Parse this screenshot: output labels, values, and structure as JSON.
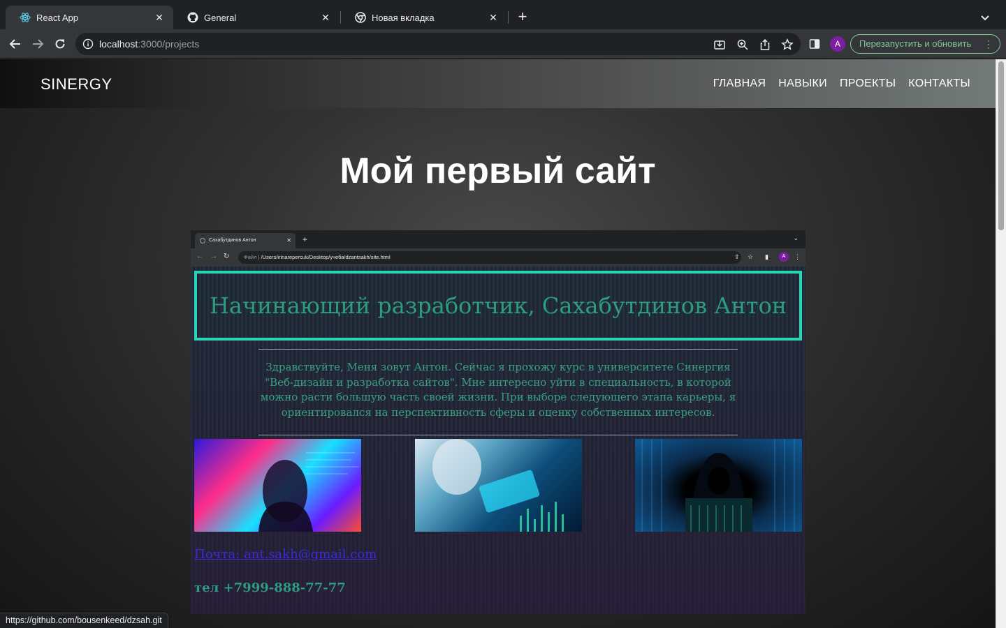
{
  "browser": {
    "tabs": [
      {
        "title": "React App",
        "icon": "react-icon",
        "active": true
      },
      {
        "title": "General",
        "icon": "github-icon",
        "active": false
      },
      {
        "title": "Новая вкладка",
        "icon": "chrome-icon",
        "active": false
      }
    ],
    "url_host": "localhost",
    "url_rest": ":3000/projects",
    "relaunch_label": "Перезапустить и обновить",
    "avatar_letter": "A",
    "status_url": "https://github.com/bousenkeed/dzsah.git"
  },
  "site": {
    "logo": "SINERGY",
    "nav": [
      "ГЛАВНАЯ",
      "НАВЫКИ",
      "ПРОЕКТЫ",
      "КОНТАКТЫ"
    ],
    "title": "Мой первый сайт"
  },
  "project_screenshot": {
    "tab_title": "Сахабутдинов Антон",
    "url_prefix": "Файл",
    "url_path": "/Users/irinarepercuk/Desktop/учеба/dzantsakh/site.html",
    "avatar_letter": "A",
    "heading": "Начинающий разработчик, Сахабутдинов Антон",
    "intro": "Здравствуйте, Меня зовут Антон. Сейчас я прохожу курс в университете Синергия \"Веб-дизайн и разработка сайтов\". Мне интересно уйти в специальность, в которой можно расти большую часть своей жизни. При выборе следующего этапа карьеры, я ориентировался на перспективность сферы и оценку собственных интересов.",
    "email_link": "Почта: ant.sakh@gmail.com",
    "phone": "тел +7999-888-77-77"
  },
  "colors": {
    "accent_green": "#81c995",
    "banner_border": "#2bd4b4",
    "heading_green": "#2e9c7e",
    "link_blue": "#3a2bd6",
    "avatar_purple": "#7b1fa2"
  }
}
